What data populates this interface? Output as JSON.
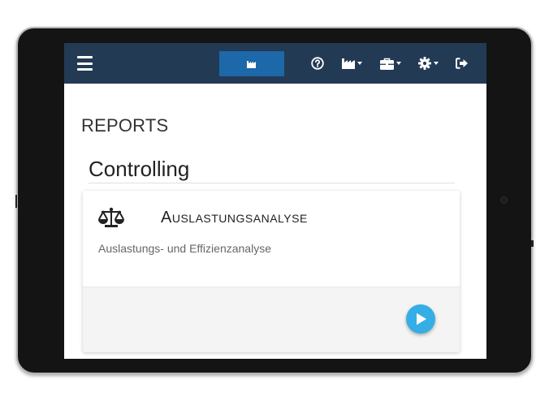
{
  "reports": {
    "section_title": "REPORTS",
    "group_title": "Controlling",
    "card": {
      "title": "Auslastungsanalyse",
      "description": "Auslastungs- und Effizienzanalyse"
    }
  },
  "navbar": {
    "icons": [
      "menu-icon",
      "factory-icon",
      "help-icon",
      "factory-icon",
      "briefcase-icon",
      "gear-icon",
      "sign-out-icon"
    ]
  },
  "colors": {
    "navbar": "#233a55",
    "brand": "#1c68a8",
    "fab": "#35aee6"
  }
}
